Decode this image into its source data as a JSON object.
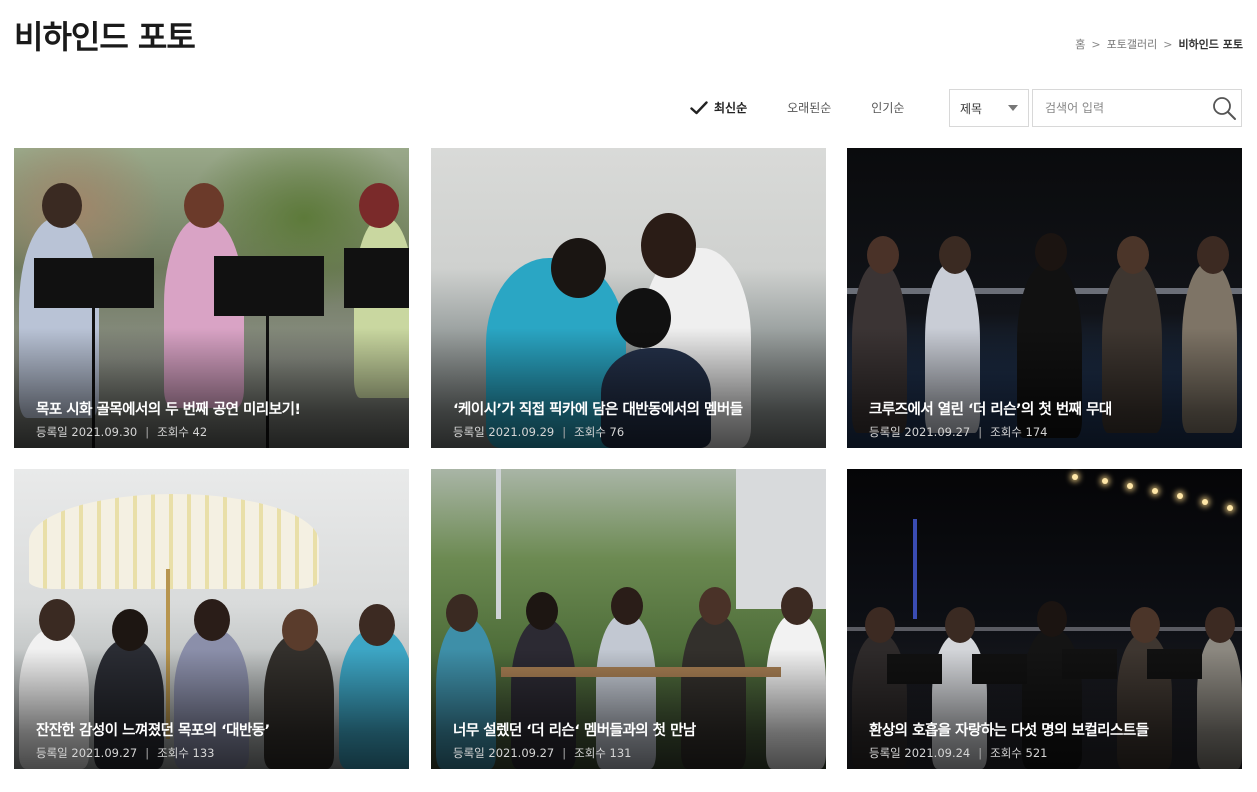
{
  "header": {
    "title": "비하인드 포토"
  },
  "breadcrumb": {
    "items": [
      "홈",
      "포토갤러리",
      "비하인드 포토"
    ],
    "separator": ">"
  },
  "sort": {
    "options": [
      "최신순",
      "오래된순",
      "인기순"
    ],
    "active": "최신순"
  },
  "search": {
    "field_label": "제목",
    "placeholder": "검색어 입력"
  },
  "labels": {
    "date_prefix": "등록일",
    "views_prefix": "조회수",
    "divider": "|"
  },
  "cards": [
    {
      "title": "목포 시화 골목에서의 두 번째 공연 미리보기!",
      "date": "2021.09.30",
      "views": "42"
    },
    {
      "title": "‘케이시’가 직접 픽카에 담은 대반동에서의 멤버들",
      "date": "2021.09.29",
      "views": "76"
    },
    {
      "title": "크루즈에서 열린 ‘더 리슨’의 첫 번째 무대",
      "date": "2021.09.27",
      "views": "174"
    },
    {
      "title": "잔잔한 감성이 느껴졌던 목포의 ‘대반동’",
      "date": "2021.09.27",
      "views": "133"
    },
    {
      "title": "너무 설렜던 ‘더 리슨‘ 멤버들과의 첫 만남",
      "date": "2021.09.27",
      "views": "131"
    },
    {
      "title": "환상의 호흡을 자랑하는 다섯 명의 보컬리스트들",
      "date": "2021.09.24",
      "views": "521"
    }
  ]
}
